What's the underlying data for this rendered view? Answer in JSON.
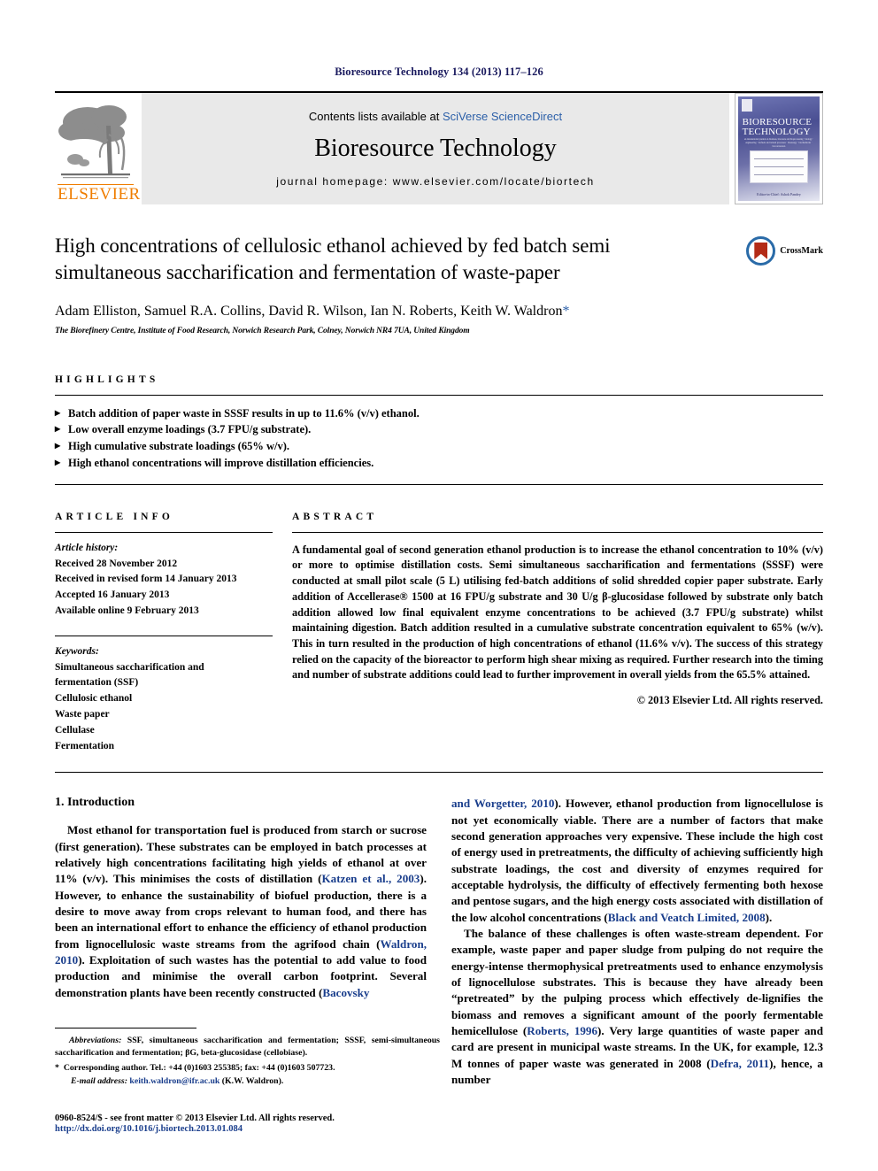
{
  "running_head": "Bioresource Technology 134 (2013) 117–126",
  "masthead": {
    "publisher": "ELSEVIER",
    "contents_prefix": "Contents lists available at ",
    "contents_link": "SciVerse ScienceDirect",
    "journal_name": "Bioresource Technology",
    "homepage": "journal homepage: www.elsevier.com/locate/biortech",
    "cover_title_line1": "BIORESOURCE",
    "cover_title_line2": "TECHNOLOGY",
    "cover_caption": "an international journal on biomass, biowaste and bioprocessing · biology · engineering · biofuels and related processes · bioenergy · biochemicals · bioconversion",
    "cover_bottom": "Editor-in-Chief: Ashok Pandey"
  },
  "article": {
    "title": "High concentrations of cellulosic ethanol achieved by fed batch semi simultaneous saccharification and fermentation of waste-paper",
    "authors": "Adam Elliston, Samuel R.A. Collins, David R. Wilson, Ian N. Roberts, Keith W. Waldron",
    "corresponding_marker": "*",
    "affiliation": "The Biorefinery Centre, Institute of Food Research, Norwich Research Park, Colney, Norwich NR4 7UA, United Kingdom",
    "crossmark_label": "CrossMark"
  },
  "highlights": {
    "heading": "HIGHLIGHTS",
    "items": [
      "Batch addition of paper waste in SSSF results in up to 11.6% (v/v) ethanol.",
      "Low overall enzyme loadings (3.7 FPU/g substrate).",
      "High cumulative substrate loadings (65% w/v).",
      "High ethanol concentrations will improve distillation efficiencies."
    ]
  },
  "article_info": {
    "heading": "ARTICLE INFO",
    "history_label": "Article history:",
    "history": [
      "Received 28 November 2012",
      "Received in revised form 14 January 2013",
      "Accepted 16 January 2013",
      "Available online 9 February 2013"
    ],
    "keywords_label": "Keywords:",
    "keywords": [
      "Simultaneous saccharification and",
      "fermentation (SSF)",
      "Cellulosic ethanol",
      "Waste paper",
      "Cellulase",
      "Fermentation"
    ]
  },
  "abstract": {
    "heading": "ABSTRACT",
    "text": "A fundamental goal of second generation ethanol production is to increase the ethanol concentration to 10% (v/v) or more to optimise distillation costs. Semi simultaneous saccharification and fermentations (SSSF) were conducted at small pilot scale (5 L) utilising fed-batch additions of solid shredded copier paper substrate. Early addition of Accellerase® 1500 at 16 FPU/g substrate and 30 U/g β-glucosidase followed by substrate only batch addition allowed low final equivalent enzyme concentrations to be achieved (3.7 FPU/g substrate) whilst maintaining digestion. Batch addition resulted in a cumulative substrate concentration equivalent to 65% (w/v). This in turn resulted in the production of high concentrations of ethanol (11.6% v/v). The success of this strategy relied on the capacity of the bioreactor to perform high shear mixing as required. Further research into the timing and number of substrate additions could lead to further improvement in overall yields from the 65.5% attained.",
    "copyright": "© 2013 Elsevier Ltd. All rights reserved."
  },
  "introduction": {
    "section_number_title": "1. Introduction",
    "left_para_1_a": "Most ethanol for transportation fuel is produced from starch or sucrose (first generation). These substrates can be employed in batch processes at relatively high concentrations facilitating high yields of ethanol at over 11% (v/v). This minimises the costs of distillation (",
    "left_ref_1": "Katzen et al., 2003",
    "left_para_1_b": "). However, to enhance the sustainability of biofuel production, there is a desire to move away from crops relevant to human food, and there has been an international effort to enhance the efficiency of ethanol production from lignocellulosic waste streams from the agrifood chain (",
    "left_ref_2": "Waldron, 2010",
    "left_para_1_c": "). Exploitation of such wastes has the potential to add value to food production and minimise the overall carbon footprint. Several demonstration plants have been recently constructed (",
    "left_ref_3": "Bacovsky",
    "right_ref_1": "and Worgetter, 2010",
    "right_para_1_a": "). However, ethanol production from lignocellulose is not yet economically viable. There are a number of factors that make second generation approaches very expensive. These include the high cost of energy used in pretreatments, the difficulty of achieving sufficiently high substrate loadings, the cost and diversity of enzymes required for acceptable hydrolysis, the difficulty of effectively fermenting both hexose and pentose sugars, and the high energy costs associated with distillation of the low alcohol concentrations (",
    "right_ref_2": "Black and Veatch Limited, 2008",
    "right_para_1_b": ").",
    "right_para_2_a": "The balance of these challenges is often waste-stream dependent. For example, waste paper and paper sludge from pulping do not require the energy-intense thermophysical pretreatments used to enhance enzymolysis of lignocellulose substrates. This is because they have already been “pretreated” by the pulping process which effectively de-lignifies the biomass and removes a significant amount of the poorly fermentable hemicellulose (",
    "right_ref_3": "Roberts, 1996",
    "right_para_2_b": "). Very large quantities of waste paper and card are present in municipal waste streams. In the UK, for example, 12.3 M tonnes of paper waste was generated in 2008 (",
    "right_ref_4": "Defra, 2011",
    "right_para_2_c": "), hence, a number"
  },
  "footnotes": {
    "abbrev_label": "Abbreviations:",
    "abbrev_text": " SSF, simultaneous saccharification and fermentation; SSSF, semi-simultaneous saccharification and fermentation; βG, beta-glucosidase (cellobiase).",
    "corresponding_marker": "*",
    "corresponding_text": "Corresponding author. Tel.: +44 (0)1603 255385; fax: +44 (0)1603 507723.",
    "email_label": "E-mail address:",
    "email_value": "keith.waldron@ifr.ac.uk",
    "email_suffix": " (K.W. Waldron)."
  },
  "footer": {
    "issn_line": "0960-8524/$ - see front matter © 2013 Elsevier Ltd. All rights reserved.",
    "doi_line": "http://dx.doi.org/10.1016/j.biortech.2013.01.084"
  },
  "colors": {
    "header_blue": "#1a1a5e",
    "link_blue": "#1a3e8c",
    "elsevier_orange": "#ef7d00",
    "banner_grey": "#e9e9e9"
  }
}
